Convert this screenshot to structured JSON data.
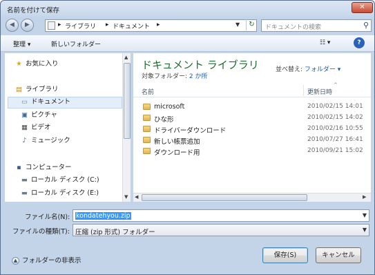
{
  "window": {
    "title": "名前を付けて保存",
    "close_label": "✕"
  },
  "address": {
    "back_icon": "back-arrow-icon",
    "forward_icon": "forward-arrow-icon",
    "crumbs": [
      "ライブラリ",
      "ドキュメント"
    ],
    "search_placeholder": "ドキュメントの検索"
  },
  "toolbar": {
    "organize_label": "整理 ▾",
    "new_folder_label": "新しいフォルダー",
    "views_label": "☷ ▾",
    "help_label": "?"
  },
  "nav": {
    "favorites": "お気に入り",
    "libraries": "ライブラリ",
    "documents": "ドキュメント",
    "pictures": "ピクチャ",
    "videos": "ビデオ",
    "music": "ミュージック",
    "computer": "コンピューター",
    "drive_c": "ローカル ディスク (C:)",
    "drive_e": "ローカル ディスク (E:)"
  },
  "library": {
    "title": "ドキュメント ライブラリ",
    "subtitle_prefix": "対象フォルダー: ",
    "subtitle_link": "2 か所",
    "arrange_label": "並べ替え: ",
    "arrange_value": "フォルダー ▾"
  },
  "columns": {
    "name": "名前",
    "modified": "更新日時"
  },
  "files": [
    {
      "name": "microsoft",
      "date": "2010/02/15 14:01"
    },
    {
      "name": "ひな形",
      "date": "2010/02/15 14:02"
    },
    {
      "name": "ドライバーダウンロード",
      "date": "2010/02/16 10:55"
    },
    {
      "name": "新しい帳票追加",
      "date": "2010/07/27 16:41"
    },
    {
      "name": "ダウンロード用",
      "date": "2010/09/21 15:02"
    }
  ],
  "form": {
    "filename_label": "ファイル名(N):",
    "filename_value": "kondatehyou.zip",
    "filetype_label": "ファイルの種類(T):",
    "filetype_value": "圧縮 (zip 形式) フォルダー"
  },
  "footer": {
    "hide_folders_label": "フォルダーの非表示",
    "save_label": "保存(S)",
    "cancel_label": "キャンセル"
  }
}
